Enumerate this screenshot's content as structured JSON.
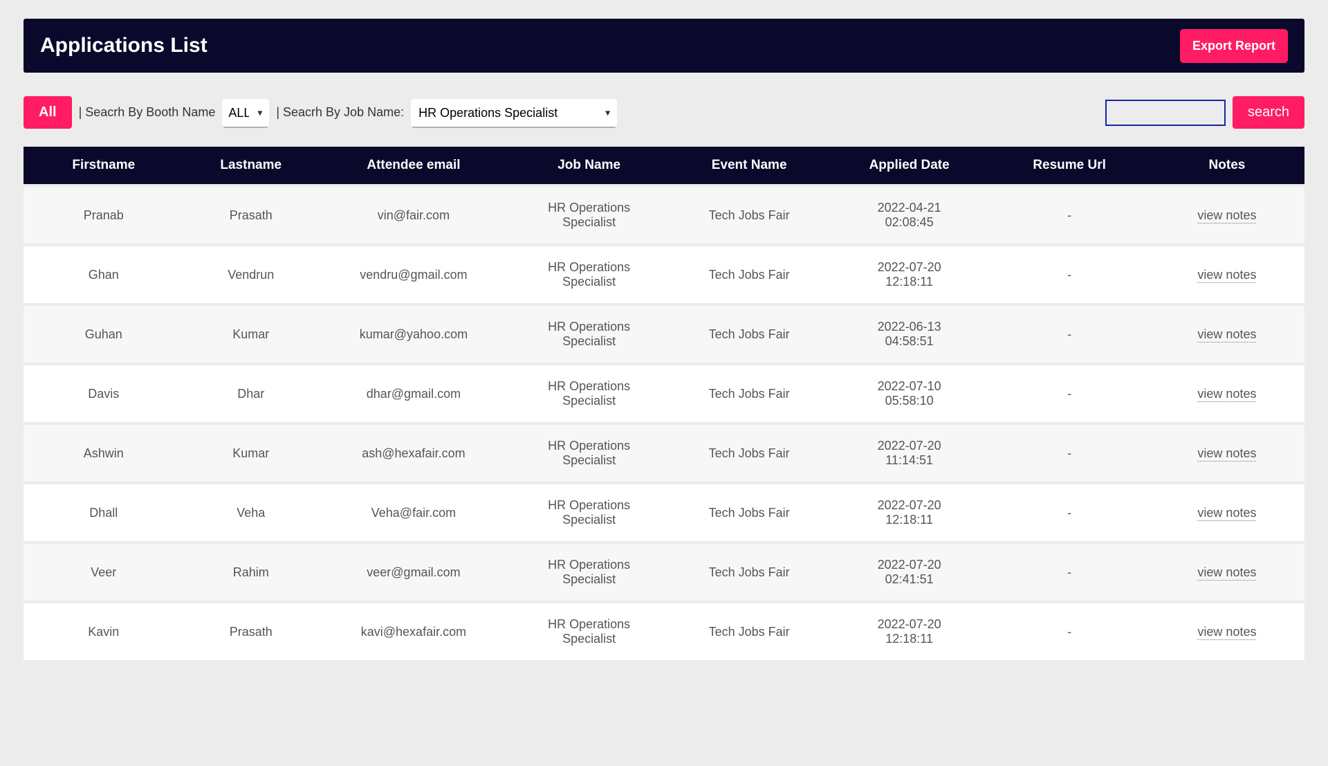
{
  "header": {
    "title": "Applications List",
    "export_label": "Export Report"
  },
  "filters": {
    "all_label": "All",
    "booth_label": "| Seacrh By Booth Name",
    "booth_selected": "ALL",
    "job_label": "| Seacrh By Job Name:",
    "job_selected": "HR Operations Specialist",
    "search_value": "",
    "search_btn": "search"
  },
  "columns": [
    "Firstname",
    "Lastname",
    "Attendee email",
    "Job Name",
    "Event Name",
    "Applied Date",
    "Resume Url",
    "Notes"
  ],
  "rows": [
    {
      "first": "Pranab",
      "last": "Prasath",
      "email": "vin@fair.com",
      "job": "HR Operations Specialist",
      "event": "Tech Jobs Fair",
      "date": "2022-04-21 02:08:45",
      "resume": "-",
      "notes": "view notes"
    },
    {
      "first": "Ghan",
      "last": "Vendrun",
      "email": "vendru@gmail.com",
      "job": "HR Operations Specialist",
      "event": "Tech Jobs Fair",
      "date": "2022-07-20 12:18:11",
      "resume": "-",
      "notes": "view notes"
    },
    {
      "first": "Guhan",
      "last": "Kumar",
      "email": "kumar@yahoo.com",
      "job": "HR Operations Specialist",
      "event": "Tech Jobs Fair",
      "date": "2022-06-13 04:58:51",
      "resume": "-",
      "notes": "view notes"
    },
    {
      "first": "Davis",
      "last": "Dhar",
      "email": "dhar@gmail.com",
      "job": "HR Operations Specialist",
      "event": "Tech Jobs Fair",
      "date": "2022-07-10 05:58:10",
      "resume": "-",
      "notes": "view notes"
    },
    {
      "first": "Ashwin",
      "last": "Kumar",
      "email": "ash@hexafair.com",
      "job": "HR Operations Specialist",
      "event": "Tech Jobs Fair",
      "date": "2022-07-20 11:14:51",
      "resume": "-",
      "notes": "view notes"
    },
    {
      "first": "Dhall",
      "last": "Veha",
      "email": "Veha@fair.com",
      "job": "HR Operations Specialist",
      "event": "Tech Jobs Fair",
      "date": "2022-07-20 12:18:11",
      "resume": "-",
      "notes": "view notes"
    },
    {
      "first": "Veer",
      "last": "Rahim",
      "email": "veer@gmail.com",
      "job": "HR Operations Specialist",
      "event": "Tech Jobs Fair",
      "date": "2022-07-20 02:41:51",
      "resume": "-",
      "notes": "view notes"
    },
    {
      "first": "Kavin",
      "last": "Prasath",
      "email": "kavi@hexafair.com",
      "job": "HR Operations Specialist",
      "event": "Tech Jobs Fair",
      "date": "2022-07-20 12:18:11",
      "resume": "-",
      "notes": "view notes"
    }
  ]
}
